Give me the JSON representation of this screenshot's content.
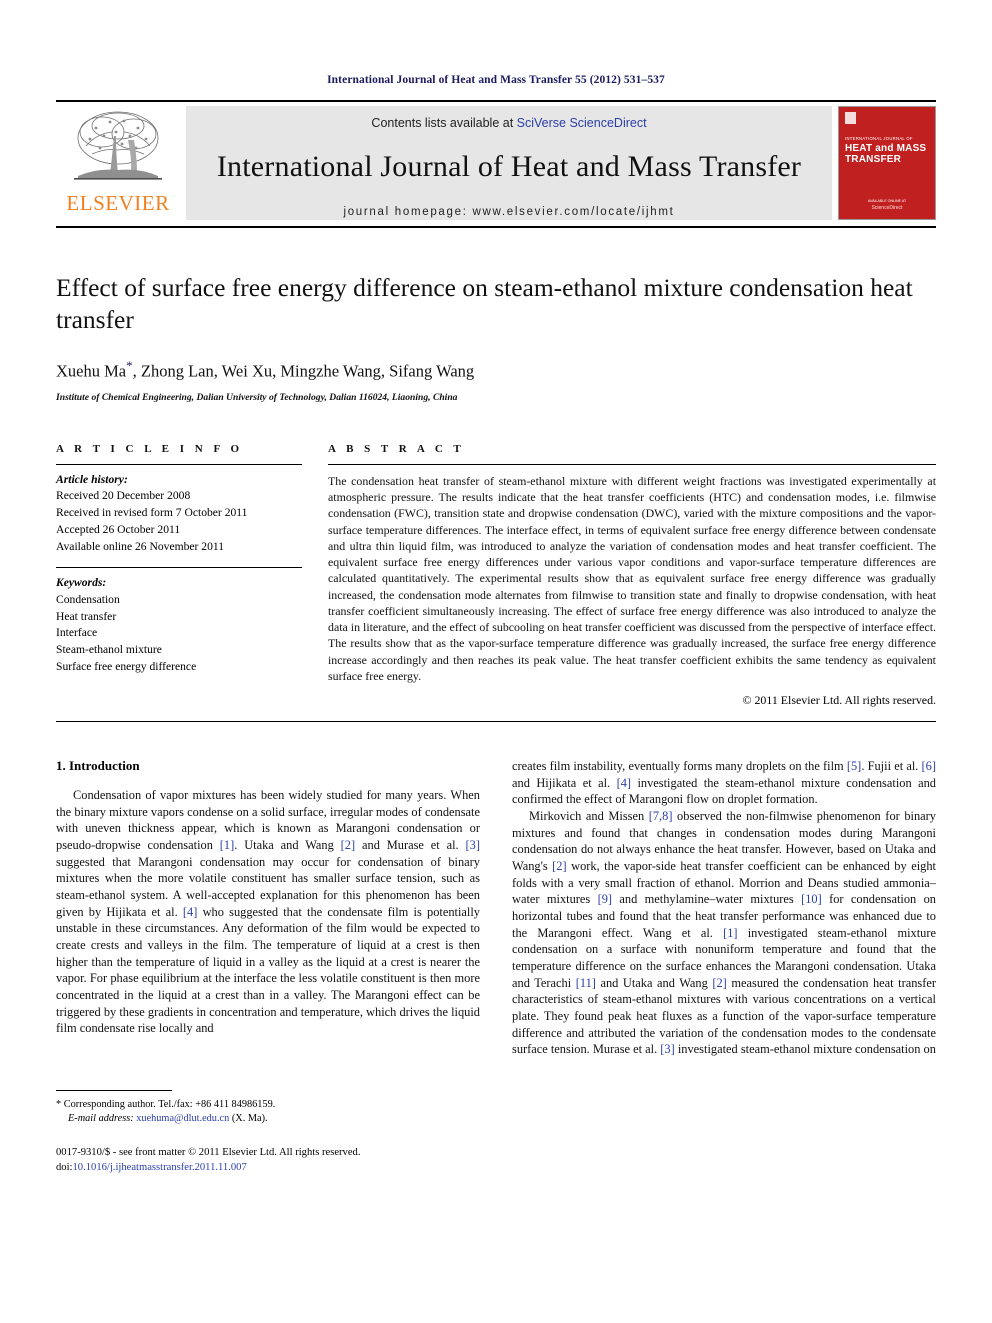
{
  "running_head": "International Journal of Heat and Mass Transfer 55 (2012) 531–537",
  "masthead": {
    "publisher_wordmark": "ELSEVIER",
    "contents_prefix": "Contents lists available at ",
    "contents_link": "SciVerse ScienceDirect",
    "journal_title": "International Journal of Heat and Mass Transfer",
    "homepage_line": "journal homepage: www.elsevier.com/locate/ijhmt",
    "cover": {
      "kicker": "INTERNATIONAL JOURNAL OF",
      "title_line1": "HEAT and MASS",
      "title_line2": "TRANSFER",
      "footer_line1": "AVAILABLE ONLINE AT",
      "footer_line2": "ScienceDirect"
    },
    "accent_orange": "#F08121",
    "cover_red": "#c0201f",
    "link_blue": "#2b3ea8"
  },
  "article": {
    "title": "Effect of surface free energy difference on steam-ethanol mixture condensation heat transfer",
    "authors": "Xuehu Ma",
    "authors_rest": ", Zhong Lan, Wei Xu, Mingzhe Wang, Sifang Wang",
    "corresponding_marker": "*",
    "affiliation": "Institute of Chemical Engineering, Dalian University of Technology, Dalian 116024, Liaoning, China"
  },
  "article_info": {
    "heading": "A R T I C L E    I N F O",
    "history_label": "Article history:",
    "history": [
      "Received 20 December 2008",
      "Received in revised form 7 October 2011",
      "Accepted 26 October 2011",
      "Available online 26 November 2011"
    ],
    "keywords_label": "Keywords:",
    "keywords": [
      "Condensation",
      "Heat transfer",
      "Interface",
      "Steam-ethanol mixture",
      "Surface free energy difference"
    ]
  },
  "abstract": {
    "heading": "A B S T R A C T",
    "text": "The condensation heat transfer of steam-ethanol mixture with different weight fractions was investigated experimentally at atmospheric pressure. The results indicate that the heat transfer coefficients (HTC) and condensation modes, i.e. filmwise condensation (FWC), transition state and dropwise condensation (DWC), varied with the mixture compositions and the vapor-surface temperature differences. The interface effect, in terms of equivalent surface free energy difference between condensate and ultra thin liquid film, was introduced to analyze the variation of condensation modes and heat transfer coefficient. The equivalent surface free energy differences under various vapor conditions and vapor-surface temperature differences are calculated quantitatively. The experimental results show that as equivalent surface free energy difference was gradually increased, the condensation mode alternates from filmwise to transition state and finally to dropwise condensation, with heat transfer coefficient simultaneously increasing. The effect of surface free energy difference was also introduced to analyze the data in literature, and the effect of subcooling on heat transfer coefficient was discussed from the perspective of interface effect. The results show that as the vapor-surface temperature difference was gradually increased, the surface free energy difference increase accordingly and then reaches its peak value. The heat transfer coefficient exhibits the same tendency as equivalent surface free energy.",
    "copyright": "© 2011 Elsevier Ltd. All rights reserved."
  },
  "body": {
    "section_number_title": "1. Introduction",
    "left_para_1_parts": [
      "Condensation of vapor mixtures has been widely studied for many years. When the binary mixture vapors condense on a solid surface, irregular modes of condensate with uneven thickness appear, which is known as Marangoni condensation or pseudo-dropwise condensation ",
      "[1]",
      ". Utaka and Wang ",
      "[2]",
      " and Murase et al. ",
      "[3]",
      " suggested that Marangoni condensation may occur for condensation of binary mixtures when the more volatile constituent has smaller surface tension, such as steam-ethanol system. A well-accepted explanation for this phenomenon has been given by Hijikata et al. ",
      "[4]",
      " who suggested that the condensate film is potentially unstable in these circumstances. Any deformation of the film would be expected to create crests and valleys in the film. The temperature of liquid at a crest is then higher than the temperature of liquid in a valley as the liquid at a crest is nearer the vapor. For phase equilibrium at the interface the less volatile constituent is then more concentrated in the liquid at a crest than in a valley. The Marangoni effect can be triggered by these gradients in concentration and temperature, which drives the liquid film condensate rise locally and"
    ],
    "right_para_1_parts": [
      "creates film instability, eventually forms many droplets on the film ",
      "[5]",
      ". Fujii et al. ",
      "[6]",
      " and Hijikata et al. ",
      "[4]",
      " investigated the steam-ethanol mixture condensation and confirmed the effect of Marangoni flow on droplet formation."
    ],
    "right_para_2_parts": [
      "Mirkovich and Missen ",
      "[7,8]",
      " observed the non-filmwise phenomenon for binary mixtures and found that changes in condensation modes during Marangoni condensation do not always enhance the heat transfer. However, based on Utaka and Wang's ",
      "[2]",
      " work, the vapor-side heat transfer coefficient can be enhanced by eight folds with a very small fraction of ethanol. Morrion and Deans studied ammonia–water mixtures ",
      "[9]",
      " and methylamine–water mixtures ",
      "[10]",
      " for condensation on horizontal tubes and found that the heat transfer performance was enhanced due to the Marangoni effect. Wang et al. ",
      "[1]",
      " investigated steam-ethanol mixture condensation on a surface with nonuniform temperature and found that the temperature difference on the surface enhances the Marangoni condensation. Utaka and Terachi ",
      "[11]",
      " and Utaka and Wang ",
      "[2]",
      " measured the condensation heat transfer characteristics of steam-ethanol mixtures with various concentrations on a vertical plate. They found peak heat fluxes as a function of the vapor-surface temperature difference and attributed the variation of the condensation modes to the condensate surface tension. Murase et al. ",
      "[3]",
      " investigated steam-ethanol mixture condensation on"
    ]
  },
  "footnote": {
    "marker": "*",
    "corresponding": "Corresponding author. Tel./fax: +86 411 84986159.",
    "email_label": "E-mail address:",
    "email": "xuehuma@dlut.edu.cn",
    "email_suffix": "(X. Ma).",
    "issn_line": "0017-9310/$ - see front matter © 2011 Elsevier Ltd. All rights reserved.",
    "doi_prefix": "doi:",
    "doi": "10.1016/j.ijheatmasstransfer.2011.11.007"
  }
}
